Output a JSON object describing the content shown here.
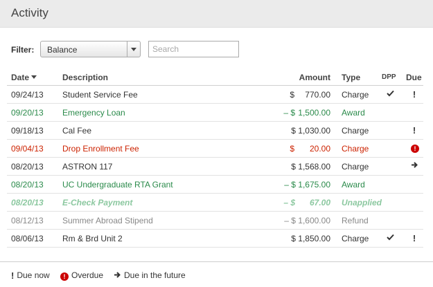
{
  "header": {
    "title": "Activity"
  },
  "filter": {
    "label": "Filter:",
    "selected": "Balance",
    "search_placeholder": "Search"
  },
  "table": {
    "columns": {
      "date": "Date",
      "description": "Description",
      "amount": "Amount",
      "type": "Type",
      "dpp": "DPP",
      "due": "Due"
    },
    "rows": [
      {
        "date": "09/24/13",
        "description": "Student Service Fee",
        "currency": "$",
        "amount": "770.00",
        "type": "Charge",
        "dpp": "check",
        "due": "due-now",
        "style": "plain"
      },
      {
        "date": "09/20/13",
        "description": "Emergency Loan",
        "currency": "– $",
        "amount": "1,500.00",
        "type": "Award",
        "dpp": "",
        "due": "",
        "style": "award"
      },
      {
        "date": "09/18/13",
        "description": "Cal Fee",
        "currency": "",
        "amount": "$ 1,030.00",
        "type": "Charge",
        "dpp": "",
        "due": "due-now",
        "style": "plain"
      },
      {
        "date": "09/04/13",
        "description": "Drop Enrollment Fee",
        "currency": "$",
        "amount": "20.00",
        "type": "Charge",
        "dpp": "",
        "due": "overdue",
        "style": "drop"
      },
      {
        "date": "08/20/13",
        "description": "ASTRON 117",
        "currency": "",
        "amount": "$ 1,568.00",
        "type": "Charge",
        "dpp": "",
        "due": "due-future",
        "style": "plain"
      },
      {
        "date": "08/20/13",
        "description": "UC Undergraduate RTA Grant",
        "currency": "",
        "amount": "– $ 1,675.00",
        "type": "Award",
        "dpp": "",
        "due": "",
        "style": "award"
      },
      {
        "date": "08/20/13",
        "description": "E-Check Payment",
        "currency": "– $",
        "amount": "67.00",
        "type": "Unapplied",
        "dpp": "",
        "due": "",
        "style": "unapplied"
      },
      {
        "date": "08/12/13",
        "description": "Summer Abroad Stipend",
        "currency": "",
        "amount": "– $ 1,600.00",
        "type": "Refund",
        "dpp": "",
        "due": "",
        "style": "refund"
      },
      {
        "date": "08/06/13",
        "description": "Rm & Brd Unit 2",
        "currency": "",
        "amount": "$ 1,850.00",
        "type": "Charge",
        "dpp": "check",
        "due": "due-now",
        "style": "plain"
      }
    ]
  },
  "legend": {
    "due_now": "Due now",
    "overdue": "Overdue",
    "due_future": "Due in the future"
  },
  "colors": {
    "award": "#2a8a4a",
    "overdue": "#cc2200",
    "unapplied": "#8cc8a0",
    "refund": "#888888"
  }
}
